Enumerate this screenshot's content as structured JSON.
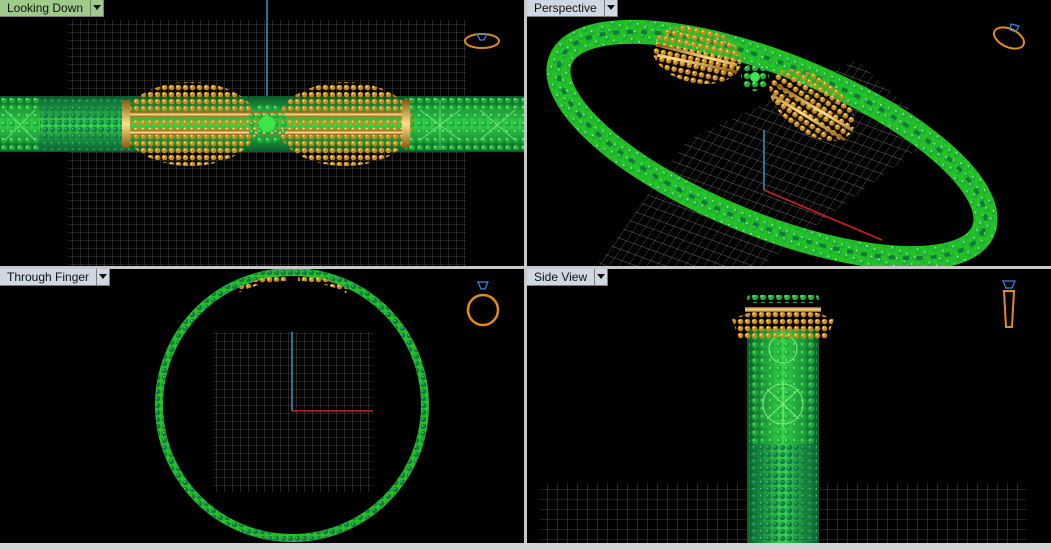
{
  "viewports": [
    {
      "id": "top-left",
      "title": "Looking Down",
      "state": "active"
    },
    {
      "id": "top-right",
      "title": "Perspective",
      "state": "inactive"
    },
    {
      "id": "bottom-left",
      "title": "Through Finger",
      "state": "inactive"
    },
    {
      "id": "bottom-right",
      "title": "Side View",
      "state": "inactive"
    }
  ],
  "colors": {
    "background": "#000000",
    "grid": "#8a8a8a",
    "axis_x": "#d02020",
    "axis_z": "#2a9ac8",
    "metal_green": "#22c51e",
    "metal_dark_green": "#0f7a3a",
    "metal_gold": "#d9a028",
    "active_tab": "#9fca8a",
    "inactive_tab": "#cfd8e3"
  },
  "icons": [
    "dropdown-arrow-icon",
    "ring-orientation-icon"
  ]
}
